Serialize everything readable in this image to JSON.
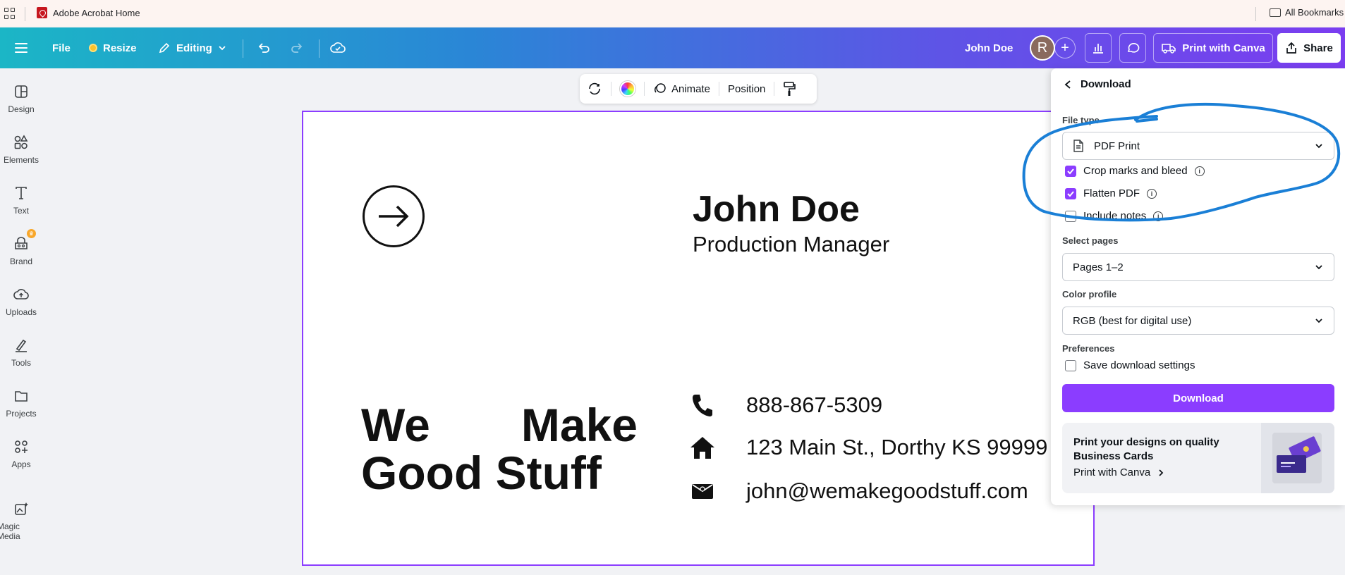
{
  "bookmarks": {
    "tab_label": "Adobe Acrobat Home",
    "all_bookmarks": "All Bookmarks"
  },
  "toolbar": {
    "file": "File",
    "resize": "Resize",
    "editing": "Editing",
    "user_name": "John Doe",
    "avatar_letter": "R",
    "print_with_canva": "Print with Canva",
    "share": "Share"
  },
  "sidebar": {
    "items": [
      {
        "label": "Design",
        "icon": "design-icon"
      },
      {
        "label": "Elements",
        "icon": "elements-icon"
      },
      {
        "label": "Text",
        "icon": "text-icon"
      },
      {
        "label": "Brand",
        "icon": "brand-icon"
      },
      {
        "label": "Uploads",
        "icon": "uploads-icon"
      },
      {
        "label": "Tools",
        "icon": "tools-icon"
      },
      {
        "label": "Projects",
        "icon": "projects-icon"
      },
      {
        "label": "Apps",
        "icon": "apps-icon"
      },
      {
        "label": "Magic Media",
        "icon": "magic-media-icon"
      }
    ]
  },
  "context_toolbar": {
    "animate": "Animate",
    "position": "Position"
  },
  "card": {
    "name": "John Doe",
    "title": "Production Manager",
    "slogan_line1_word1": "We",
    "slogan_line1_word2": "Make",
    "slogan_line2": "Good Stuff",
    "phone": "888-867-5309",
    "address": "123 Main St., Dorthy KS 99999",
    "email": "john@wemakegoodstuff.com"
  },
  "download_panel": {
    "title": "Download",
    "file_type_label": "File type",
    "file_type_value": "PDF Print",
    "crop_marks": "Crop marks and bleed",
    "crop_marks_checked": true,
    "flatten_pdf": "Flatten PDF",
    "flatten_pdf_checked": true,
    "include_notes": "Include notes",
    "include_notes_checked": false,
    "select_pages_label": "Select pages",
    "select_pages_value": "Pages 1–2",
    "color_profile_label": "Color profile",
    "color_profile_value": "RGB (best for digital use)",
    "preferences_label": "Preferences",
    "save_settings": "Save download settings",
    "save_settings_checked": false,
    "download_button": "Download",
    "promo_text": "Print your designs on quality Business Cards",
    "promo_link": "Print with Canva"
  },
  "colors": {
    "accent": "#8b3dff",
    "annotation": "#1a7fd6"
  }
}
